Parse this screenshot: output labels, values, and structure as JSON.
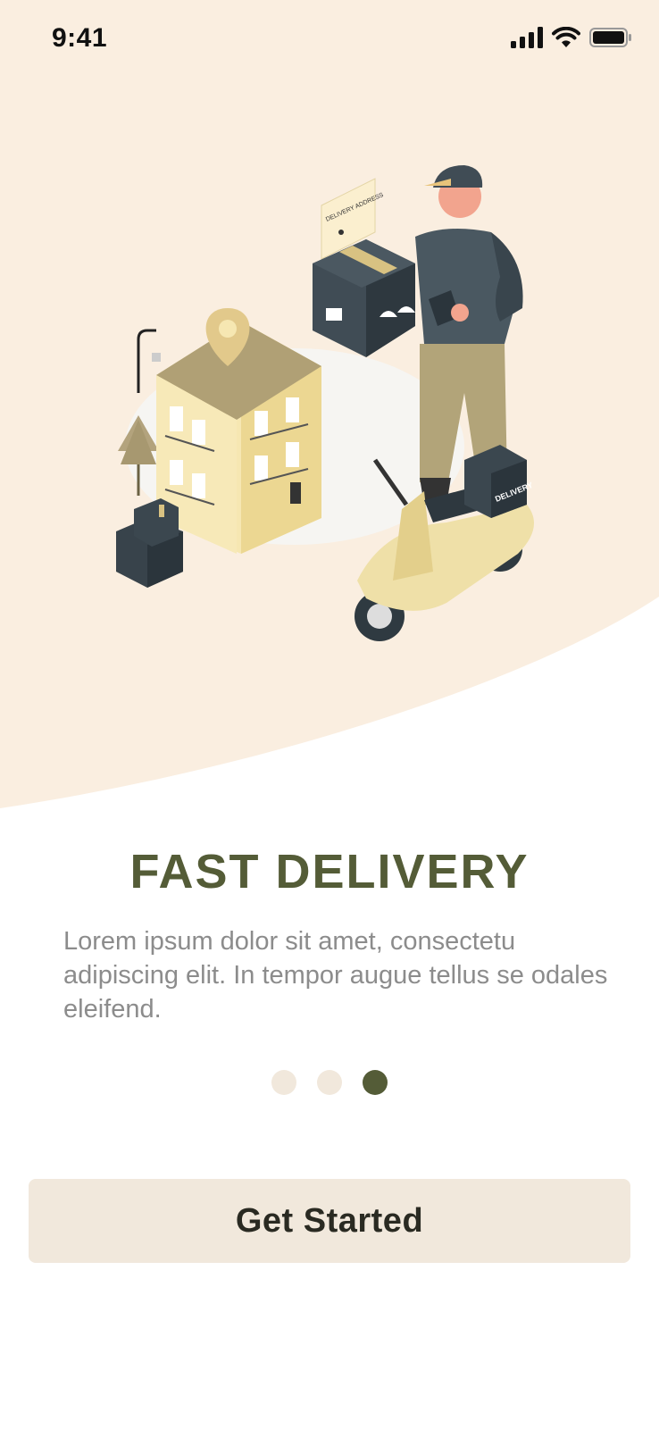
{
  "status_bar": {
    "time": "9:41"
  },
  "illustration": {
    "address_label": "DELIVERY ADDRESS",
    "box_label": "DELIVERY"
  },
  "onboarding": {
    "title": "FAST DELIVERY",
    "description": "Lorem ipsum dolor sit amet, consectetu adipiscing elit. In tempor augue tellus se odales eleifend.",
    "page_indicator": {
      "total": 3,
      "current": 3
    }
  },
  "cta": {
    "label": "Get Started"
  },
  "colors": {
    "hero_background": "#faeee0",
    "accent": "#545c37",
    "dot_inactive": "#f1e8dc",
    "button_background": "#f1e8dc",
    "description_text": "#8c8c8c"
  },
  "icons": [
    "cellular-signal-icon",
    "wifi-icon",
    "battery-icon"
  ]
}
